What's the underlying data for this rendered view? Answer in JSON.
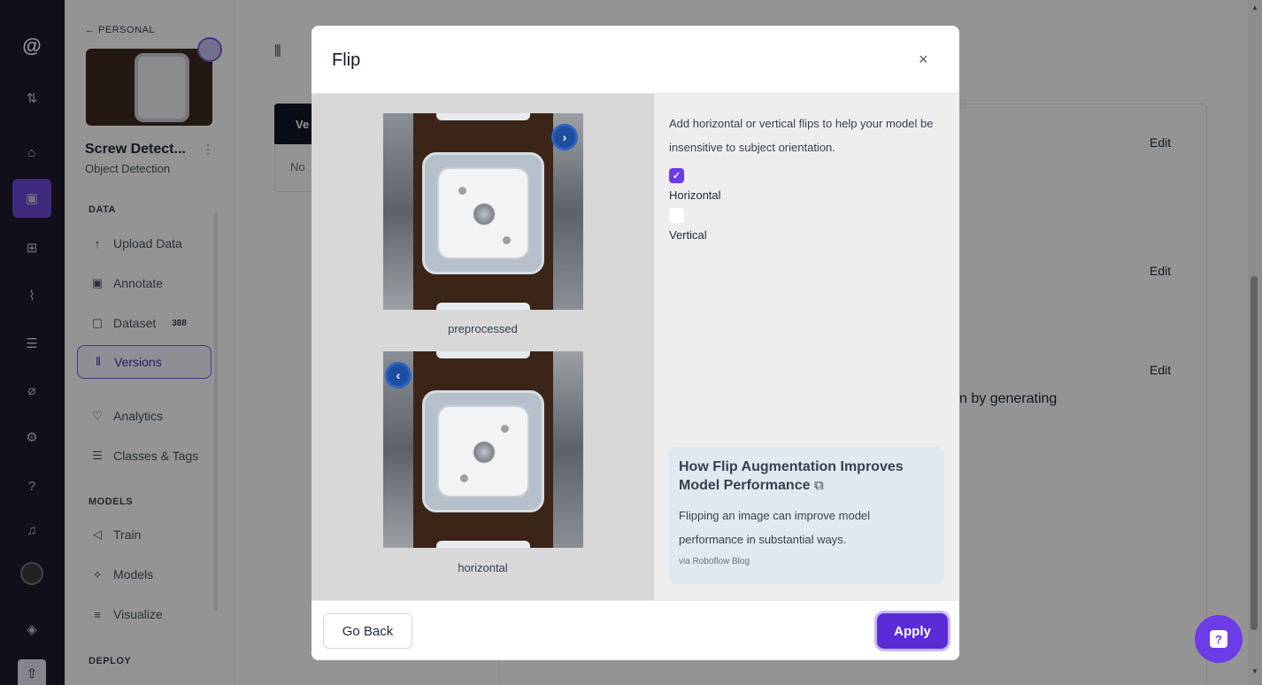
{
  "rail": {
    "items": [
      "logo-icon",
      "sort-icon",
      "home-icon",
      "inbox-icon",
      "hierarchy-icon",
      "chart-icon",
      "database-icon",
      "compass-icon",
      "settings-icon",
      "help-circle-icon",
      "bell-icon",
      "avatar",
      "stack-icon",
      "upload-icon"
    ]
  },
  "sidebar": {
    "back_label": "← PERSONAL",
    "project_name": "Screw Detect...",
    "project_kebab": "⋮",
    "project_type": "Object Detection",
    "sections": {
      "data": "DATA",
      "models": "MODELS",
      "deploy": "DEPLOY"
    },
    "items": [
      {
        "label": "Upload Data",
        "icon": "↑"
      },
      {
        "label": "Annotate",
        "icon": "▣"
      },
      {
        "label": "Dataset",
        "icon": "▢",
        "badge": "388"
      },
      {
        "label": "Versions",
        "icon": "⫴"
      },
      {
        "label": "Analytics",
        "icon": "♡"
      },
      {
        "label": "Classes & Tags",
        "icon": "☰"
      },
      {
        "label": "Train",
        "icon": "◁"
      },
      {
        "label": "Models",
        "icon": "⟡"
      },
      {
        "label": "Visualize",
        "icon": "≡"
      }
    ]
  },
  "main": {
    "versions_header": "Ve",
    "versions_empty": "No",
    "edit_label": "Edit",
    "partial_text": "n by generating"
  },
  "modal": {
    "title": "Flip",
    "close": "×",
    "previews": [
      {
        "caption": "preprocessed"
      },
      {
        "caption": "horizontal"
      }
    ],
    "description": "Add horizontal or vertical flips to help your model be insensitive to subject orientation.",
    "options": [
      {
        "label": "Horizontal",
        "checked": true
      },
      {
        "label": "Vertical",
        "checked": false
      }
    ],
    "info_card": {
      "title": "How Flip Augmentation Improves Model Performance",
      "external_icon": "⧉",
      "body": "Flipping an image can improve model performance in substantial ways.",
      "source": "via Roboflow Blog"
    },
    "buttons": {
      "back": "Go Back",
      "apply": "Apply"
    }
  },
  "help_fab": "?",
  "colors": {
    "accent": "#6b3ce8",
    "rail_bg": "#1c1b2e",
    "apply": "#5b2bd6"
  }
}
